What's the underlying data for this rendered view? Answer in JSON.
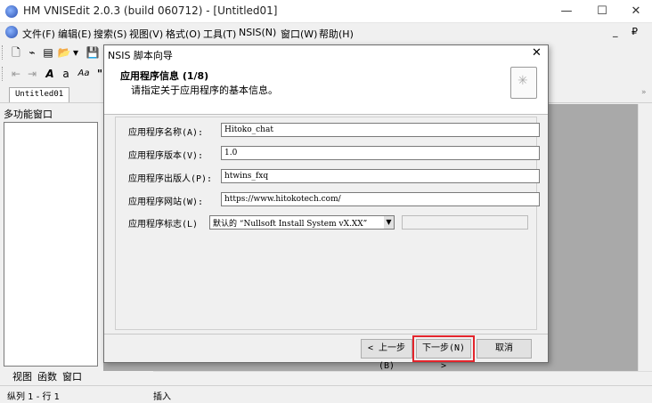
{
  "window": {
    "title": "HM VNISEdit 2.0.3 (build 060712) - [Untitled01]",
    "minimize": "—",
    "maximize": "☐",
    "close": "✕"
  },
  "menu": {
    "items": [
      "文件(F)",
      "编辑(E)",
      "搜索(S)",
      "视图(V)",
      "格式(O)",
      "工具(T)",
      "NSIS(N)",
      "窗口(W)",
      "帮助(H)"
    ],
    "mdi_controls": "_ ₽ ×"
  },
  "toolbar": {
    "row1": [
      "🗋",
      "⌁",
      "▤",
      "📂",
      "▾",
      "💾"
    ],
    "row2": [
      "⇤",
      "⇥",
      "A",
      "a",
      "Aa",
      "\""
    ]
  },
  "tabs": {
    "editor_tab": "Untitled01",
    "more": "»"
  },
  "left_panel": {
    "title": "多功能窗口",
    "bottom_tabs": [
      "视图",
      "函数",
      "窗口"
    ]
  },
  "status": {
    "position": "纵列 1 - 行 1",
    "mode": "插入"
  },
  "dialog": {
    "title": "NSIS 脚本向导",
    "close": "✕",
    "heading": "应用程序信息 (1/8)",
    "subheading": "请指定关于应用程序的基本信息。",
    "header_image_glyph": "✳",
    "fields": [
      {
        "label": "应用程序名称(A):",
        "value": "Hitoko_chat"
      },
      {
        "label": "应用程序版本(V):",
        "value": "1.0"
      },
      {
        "label": "应用程序出版人(P):",
        "value": "htwins_fxq"
      },
      {
        "label": "应用程序网站(W):",
        "value": "https://www.hitokotech.com/"
      }
    ],
    "logo_label": "应用程序标志(L)",
    "logo_value": "默认的 “Nullsoft Install System vX.XX”",
    "logo_arrow": "▼",
    "back_button": "< 上一步(B)",
    "next_button": "下一步(N) >",
    "cancel_button": "取消",
    "highlight_color": "#e3252c"
  }
}
